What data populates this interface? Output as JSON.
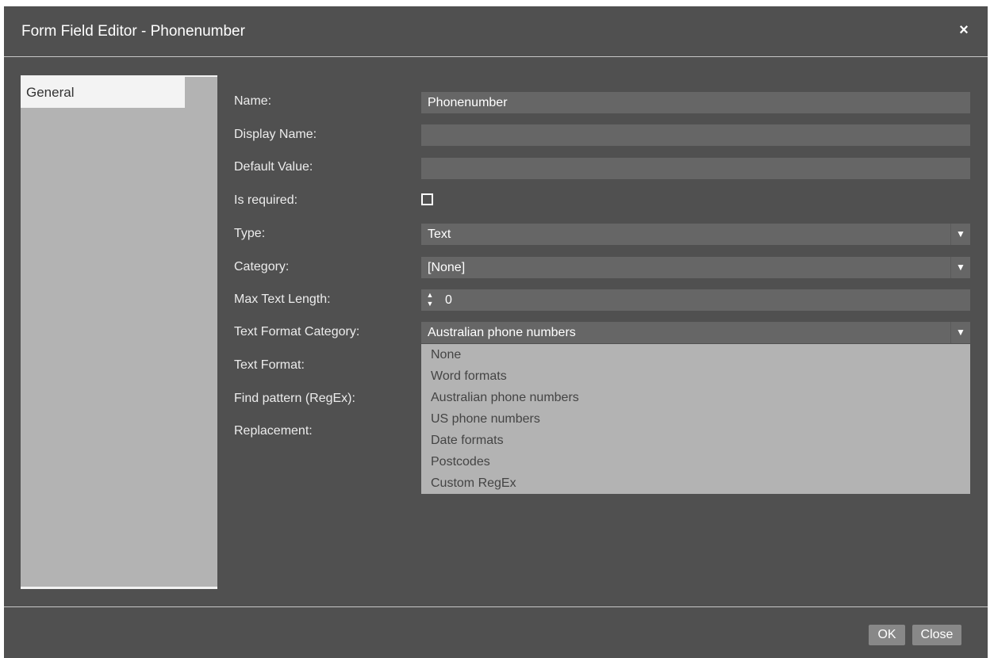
{
  "dialog": {
    "title": "Form Field Editor - Phonenumber",
    "close_glyph": "×"
  },
  "nav": {
    "items": [
      {
        "label": "General"
      }
    ]
  },
  "form": {
    "name_label": "Name:",
    "name_value": "Phonenumber",
    "display_name_label": "Display Name:",
    "display_name_value": "",
    "default_value_label": "Default Value:",
    "default_value_value": "",
    "is_required_label": "Is required:",
    "is_required_checked": false,
    "type_label": "Type:",
    "type_value": "Text",
    "category_label": "Category:",
    "category_value": "[None]",
    "max_text_length_label": "Max Text Length:",
    "max_text_length_value": "0",
    "text_format_category_label": "Text Format Category:",
    "text_format_category_value": "Australian phone numbers",
    "text_format_label": "Text Format:",
    "find_pattern_label": "Find pattern (RegEx):",
    "replacement_label": "Replacement:"
  },
  "dropdown": {
    "options": [
      "None",
      "Word formats",
      "Australian phone numbers",
      "US phone numbers",
      "Date formats",
      "Postcodes",
      "Custom RegEx"
    ]
  },
  "buttons": {
    "ok": "OK",
    "close": "Close"
  },
  "icons": {
    "dropdown_arrow": "▼",
    "spin_up": "▲",
    "spin_down": "▼"
  },
  "colors": {
    "dialog_bg": "#505050",
    "field_bg": "#666666",
    "panel_bg": "#b3b3b3",
    "button_bg": "#888888"
  }
}
